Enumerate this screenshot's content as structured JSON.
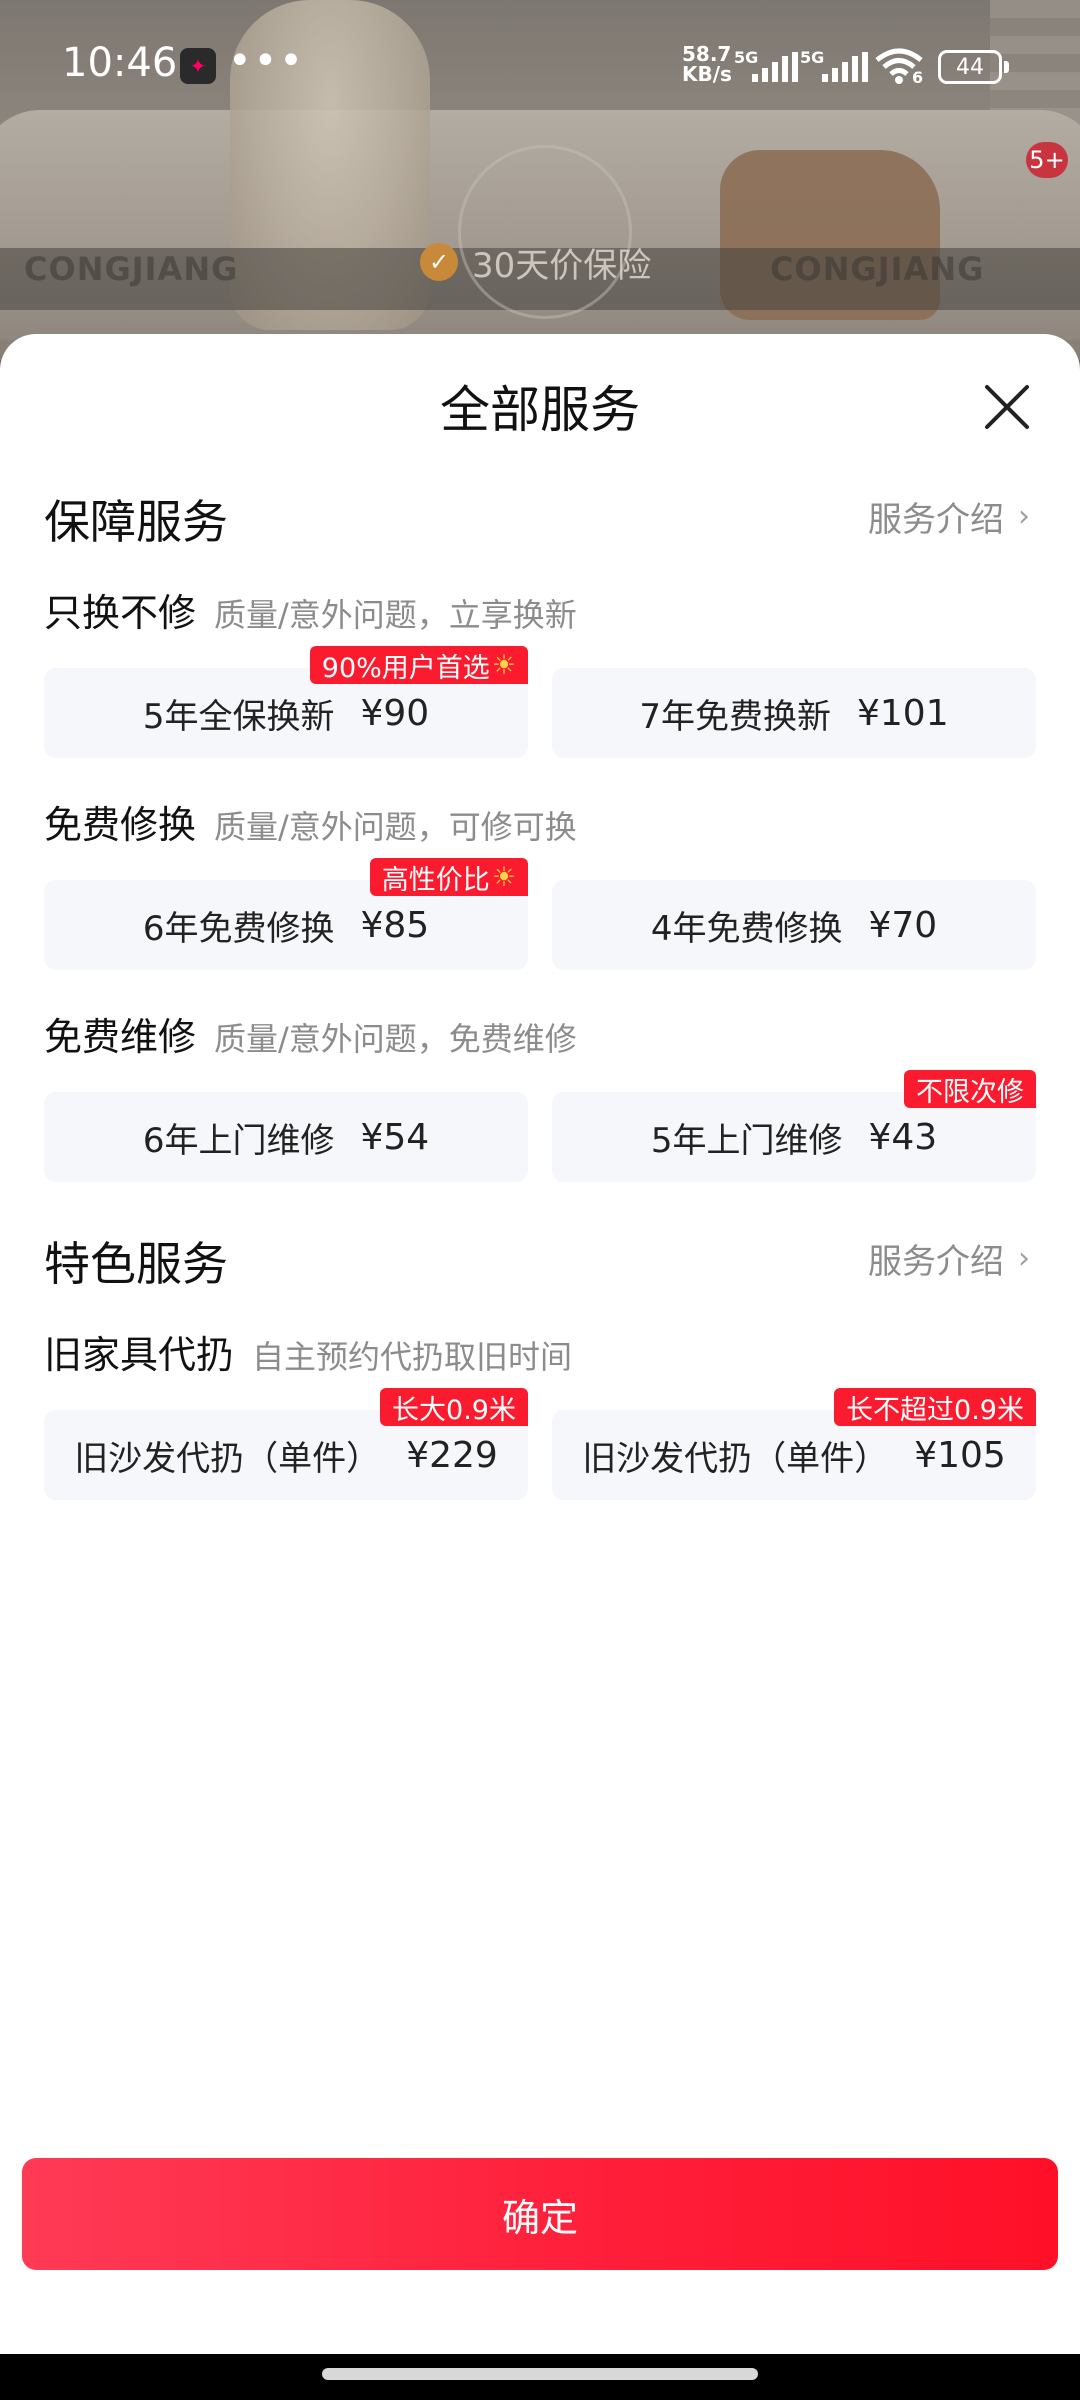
{
  "status_bar": {
    "time": "10:46",
    "more": "•••",
    "net_speed_value": "58.7",
    "net_speed_unit": "KB/s",
    "sim1": "5G",
    "sim2": "5G",
    "wifi_level": "6",
    "battery": "44"
  },
  "background": {
    "brand_left": "CONGJIANG",
    "brand_right": "CONGJIANG",
    "guarantee": "30天价保险",
    "badge": "5+"
  },
  "sheet": {
    "title": "全部服务",
    "sections": [
      {
        "title": "保障服务",
        "link": "服务介绍",
        "groups": [
          {
            "title": "只换不修",
            "desc": "质量/意外问题，立享换新",
            "options": [
              {
                "label": "5年全保换新",
                "price": "¥90",
                "badge": "90%用户首选",
                "badge_icon": "sun-icon"
              },
              {
                "label": "7年免费换新",
                "price": "¥101"
              }
            ]
          },
          {
            "title": "免费修换",
            "desc": "质量/意外问题，可修可换",
            "options": [
              {
                "label": "6年免费修换",
                "price": "¥85",
                "badge": "高性价比",
                "badge_icon": "sun-icon"
              },
              {
                "label": "4年免费修换",
                "price": "¥70"
              }
            ]
          },
          {
            "title": "免费维修",
            "desc": "质量/意外问题，免费维修",
            "options": [
              {
                "label": "6年上门维修",
                "price": "¥54"
              },
              {
                "label": "5年上门维修",
                "price": "¥43",
                "badge": "不限次修"
              }
            ]
          }
        ]
      },
      {
        "title": "特色服务",
        "link": "服务介绍",
        "groups": [
          {
            "title": "旧家具代扔",
            "desc": "自主预约代扔取旧时间",
            "options": [
              {
                "label": "旧沙发代扔（单件）",
                "price": "¥229",
                "badge": "长大0.9米"
              },
              {
                "label": "旧沙发代扔（单件）",
                "price": "¥105",
                "badge": "长不超过0.9米"
              }
            ]
          }
        ]
      }
    ]
  },
  "confirm_label": "确定",
  "colors": {
    "accent": "#fb1b2e",
    "button_gradient_start": "#ff3a55",
    "button_gradient_end": "#ff1028",
    "option_bg": "#f6f7fa"
  }
}
